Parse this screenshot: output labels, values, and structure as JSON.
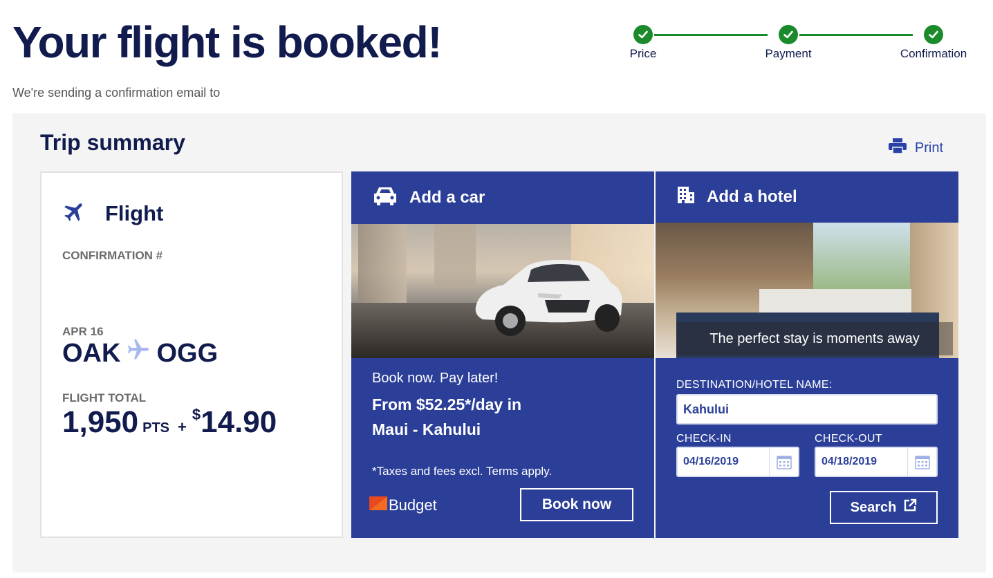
{
  "header": {
    "title": "Your flight is booked!",
    "subtitle": "We're sending a confirmation email to"
  },
  "progress": {
    "steps": [
      {
        "label": "Price",
        "status": "complete"
      },
      {
        "label": "Payment",
        "status": "complete"
      },
      {
        "label": "Confirmation",
        "status": "complete"
      }
    ],
    "color": "#1a8a2a"
  },
  "summary": {
    "title": "Trip summary",
    "print_label": "Print"
  },
  "flight": {
    "heading": "Flight",
    "confirmation_label": "CONFIRMATION #",
    "date": "APR 16",
    "origin": "OAK",
    "destination": "OGG",
    "total_label": "FLIGHT TOTAL",
    "points": "1,950",
    "points_unit": "PTS",
    "plus": "+",
    "currency": "$",
    "cash": "14.90"
  },
  "car": {
    "heading": "Add a car",
    "line1": "Book now. Pay later!",
    "line2": "From $52.25*/day in Maui - Kahului",
    "terms": "*Taxes and fees excl. Terms apply.",
    "partner": "Budget",
    "button": "Book now"
  },
  "hotel": {
    "heading": "Add a hotel",
    "image_caption": "The perfect stay is moments away",
    "destination_label": "DESTINATION/HOTEL NAME:",
    "destination_value": "Kahului",
    "checkin_label": "CHECK-IN",
    "checkin_value": "04/16/2019",
    "checkout_label": "CHECK-OUT",
    "checkout_value": "04/18/2019",
    "button": "Search"
  },
  "colors": {
    "brand_blue": "#2b3f98",
    "navy": "#111b4d",
    "success": "#1a8a2a",
    "budget_orange": "#e8491d"
  }
}
